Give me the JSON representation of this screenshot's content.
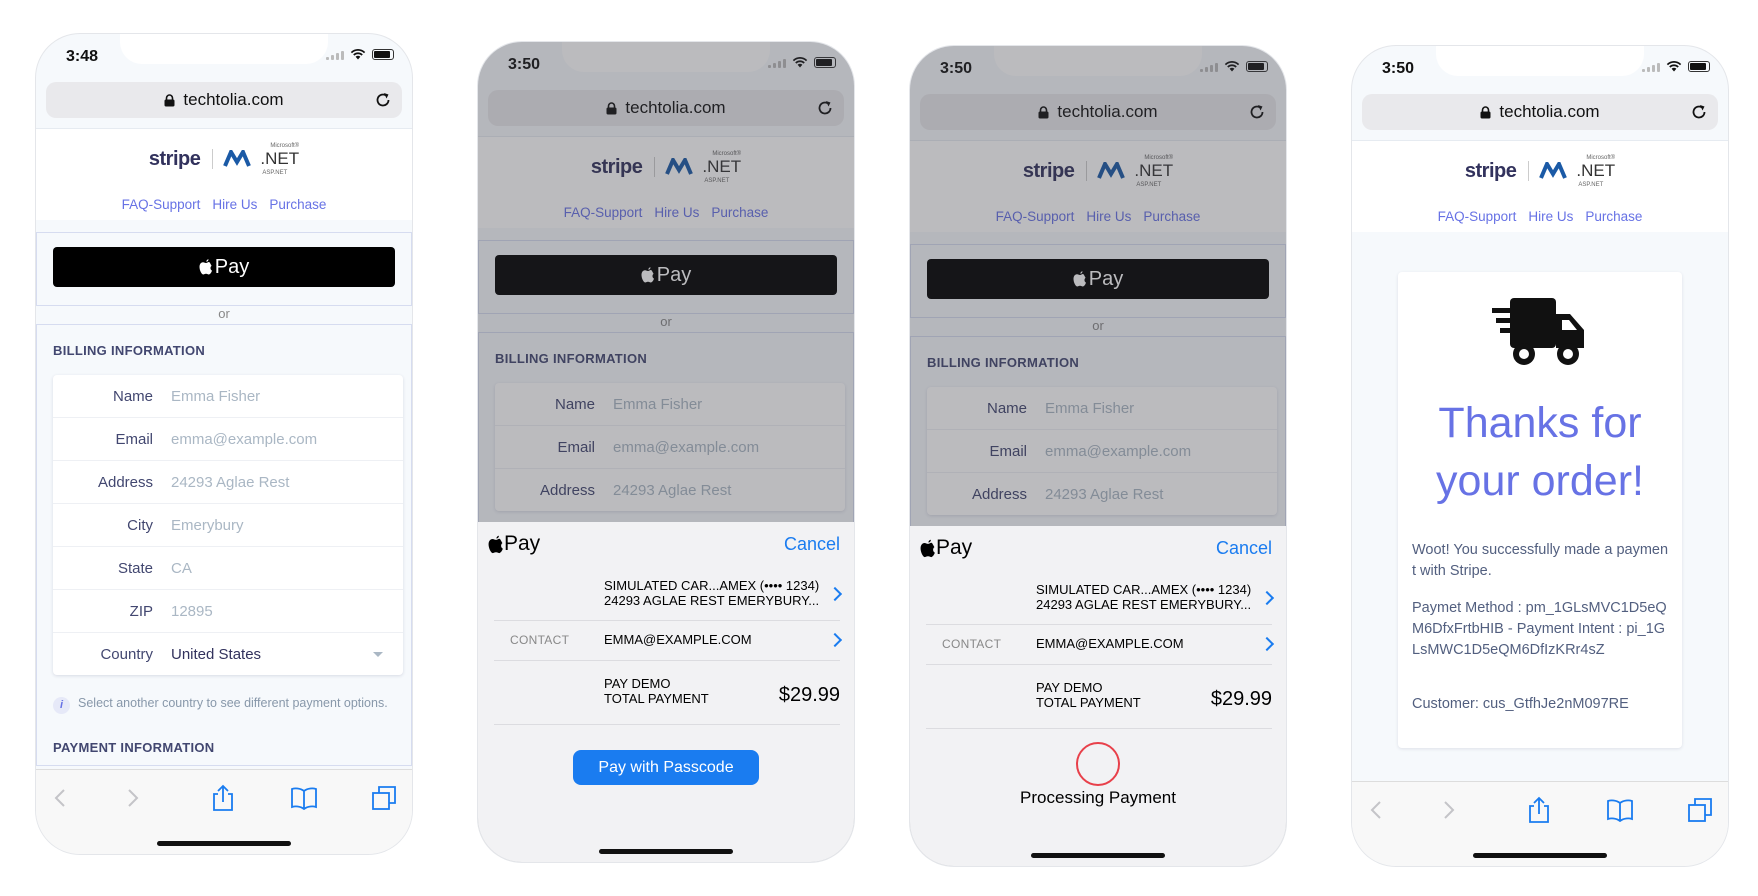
{
  "colors": {
    "accent": "#6772e5",
    "ios_blue": "#1a7cf0",
    "spinner": "#e8404a"
  },
  "site": {
    "url": "techtolia.com",
    "logo_stripe": "stripe",
    "logo_net": ".NET",
    "logo_ms": "Microsoft®",
    "logo_asp": "ASP.NET",
    "nav": [
      "FAQ-Support",
      "Hire Us",
      "Purchase"
    ],
    "applepay": "Pay",
    "or": "or",
    "billing_heading": "BILLING INFORMATION",
    "fields": [
      {
        "label": "Name",
        "value": "Emma Fisher"
      },
      {
        "label": "Email",
        "value": "emma@example.com"
      },
      {
        "label": "Address",
        "value": "24293 Aglae Rest"
      },
      {
        "label": "City",
        "value": "Emerybury"
      },
      {
        "label": "State",
        "value": "CA"
      },
      {
        "label": "ZIP",
        "value": "12895"
      },
      {
        "label": "Country",
        "value": "United States"
      }
    ],
    "note": "Select another country to see different payment options.",
    "payment_heading": "PAYMENT INFORMATION"
  },
  "screens": {
    "s1": {
      "time": "3:48"
    },
    "s2": {
      "time": "3:50"
    },
    "s3": {
      "time": "3:50"
    },
    "s4": {
      "time": "3:50"
    }
  },
  "sheet": {
    "logo": "Pay",
    "cancel": "Cancel",
    "card_line1": "SIMULATED CAR...AMEX (•••• 1234)",
    "card_line2": "24293 AGLAE REST EMERYBURY...",
    "contact_label": "CONTACT",
    "contact_value": "EMMA@EXAMPLE.COM",
    "pay_line1": "PAY DEMO",
    "pay_line2": "TOTAL PAYMENT",
    "amount": "$29.99",
    "pay_button": "Pay with Passcode",
    "processing": "Processing Payment"
  },
  "success": {
    "thanks_line1": "Thanks for",
    "thanks_line2": "your order!",
    "message": "Woot! You successfully made a payment with Stripe.",
    "method": "Paymet Method : pm_1GLsMVC1D5eQM6DfxFrtbHIB - Payment Intent : pi_1GLsMWC1D5eQM6DfIzKRr4sZ",
    "customer": "Customer: cus_GtfhJe2nM097RE",
    "icon": "truck-icon"
  }
}
